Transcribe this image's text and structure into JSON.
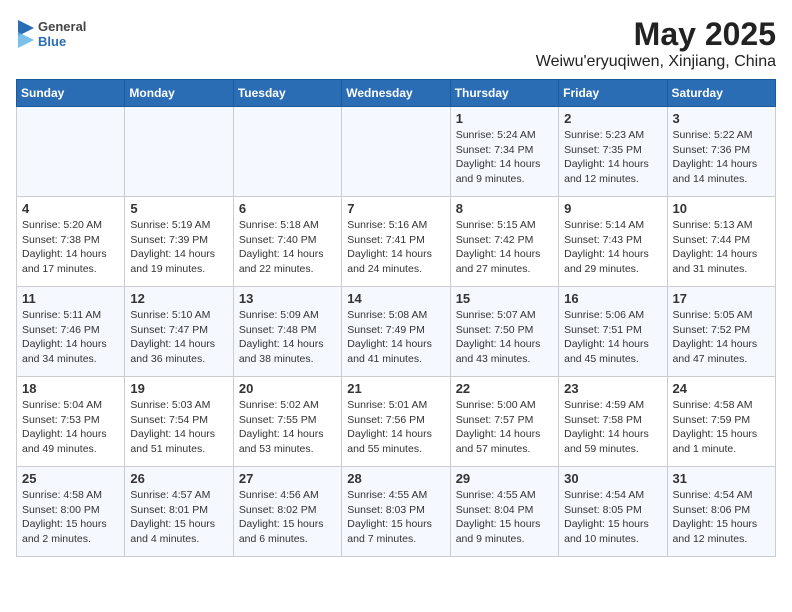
{
  "header": {
    "logo_general": "General",
    "logo_blue": "Blue",
    "title": "May 2025",
    "subtitle": "Weiwu'eryuqiwen, Xinjiang, China"
  },
  "days_of_week": [
    "Sunday",
    "Monday",
    "Tuesday",
    "Wednesday",
    "Thursday",
    "Friday",
    "Saturday"
  ],
  "weeks": [
    [
      {
        "day": "",
        "detail": ""
      },
      {
        "day": "",
        "detail": ""
      },
      {
        "day": "",
        "detail": ""
      },
      {
        "day": "",
        "detail": ""
      },
      {
        "day": "1",
        "detail": "Sunrise: 5:24 AM\nSunset: 7:34 PM\nDaylight: 14 hours\nand 9 minutes."
      },
      {
        "day": "2",
        "detail": "Sunrise: 5:23 AM\nSunset: 7:35 PM\nDaylight: 14 hours\nand 12 minutes."
      },
      {
        "day": "3",
        "detail": "Sunrise: 5:22 AM\nSunset: 7:36 PM\nDaylight: 14 hours\nand 14 minutes."
      }
    ],
    [
      {
        "day": "4",
        "detail": "Sunrise: 5:20 AM\nSunset: 7:38 PM\nDaylight: 14 hours\nand 17 minutes."
      },
      {
        "day": "5",
        "detail": "Sunrise: 5:19 AM\nSunset: 7:39 PM\nDaylight: 14 hours\nand 19 minutes."
      },
      {
        "day": "6",
        "detail": "Sunrise: 5:18 AM\nSunset: 7:40 PM\nDaylight: 14 hours\nand 22 minutes."
      },
      {
        "day": "7",
        "detail": "Sunrise: 5:16 AM\nSunset: 7:41 PM\nDaylight: 14 hours\nand 24 minutes."
      },
      {
        "day": "8",
        "detail": "Sunrise: 5:15 AM\nSunset: 7:42 PM\nDaylight: 14 hours\nand 27 minutes."
      },
      {
        "day": "9",
        "detail": "Sunrise: 5:14 AM\nSunset: 7:43 PM\nDaylight: 14 hours\nand 29 minutes."
      },
      {
        "day": "10",
        "detail": "Sunrise: 5:13 AM\nSunset: 7:44 PM\nDaylight: 14 hours\nand 31 minutes."
      }
    ],
    [
      {
        "day": "11",
        "detail": "Sunrise: 5:11 AM\nSunset: 7:46 PM\nDaylight: 14 hours\nand 34 minutes."
      },
      {
        "day": "12",
        "detail": "Sunrise: 5:10 AM\nSunset: 7:47 PM\nDaylight: 14 hours\nand 36 minutes."
      },
      {
        "day": "13",
        "detail": "Sunrise: 5:09 AM\nSunset: 7:48 PM\nDaylight: 14 hours\nand 38 minutes."
      },
      {
        "day": "14",
        "detail": "Sunrise: 5:08 AM\nSunset: 7:49 PM\nDaylight: 14 hours\nand 41 minutes."
      },
      {
        "day": "15",
        "detail": "Sunrise: 5:07 AM\nSunset: 7:50 PM\nDaylight: 14 hours\nand 43 minutes."
      },
      {
        "day": "16",
        "detail": "Sunrise: 5:06 AM\nSunset: 7:51 PM\nDaylight: 14 hours\nand 45 minutes."
      },
      {
        "day": "17",
        "detail": "Sunrise: 5:05 AM\nSunset: 7:52 PM\nDaylight: 14 hours\nand 47 minutes."
      }
    ],
    [
      {
        "day": "18",
        "detail": "Sunrise: 5:04 AM\nSunset: 7:53 PM\nDaylight: 14 hours\nand 49 minutes."
      },
      {
        "day": "19",
        "detail": "Sunrise: 5:03 AM\nSunset: 7:54 PM\nDaylight: 14 hours\nand 51 minutes."
      },
      {
        "day": "20",
        "detail": "Sunrise: 5:02 AM\nSunset: 7:55 PM\nDaylight: 14 hours\nand 53 minutes."
      },
      {
        "day": "21",
        "detail": "Sunrise: 5:01 AM\nSunset: 7:56 PM\nDaylight: 14 hours\nand 55 minutes."
      },
      {
        "day": "22",
        "detail": "Sunrise: 5:00 AM\nSunset: 7:57 PM\nDaylight: 14 hours\nand 57 minutes."
      },
      {
        "day": "23",
        "detail": "Sunrise: 4:59 AM\nSunset: 7:58 PM\nDaylight: 14 hours\nand 59 minutes."
      },
      {
        "day": "24",
        "detail": "Sunrise: 4:58 AM\nSunset: 7:59 PM\nDaylight: 15 hours\nand 1 minute."
      }
    ],
    [
      {
        "day": "25",
        "detail": "Sunrise: 4:58 AM\nSunset: 8:00 PM\nDaylight: 15 hours\nand 2 minutes."
      },
      {
        "day": "26",
        "detail": "Sunrise: 4:57 AM\nSunset: 8:01 PM\nDaylight: 15 hours\nand 4 minutes."
      },
      {
        "day": "27",
        "detail": "Sunrise: 4:56 AM\nSunset: 8:02 PM\nDaylight: 15 hours\nand 6 minutes."
      },
      {
        "day": "28",
        "detail": "Sunrise: 4:55 AM\nSunset: 8:03 PM\nDaylight: 15 hours\nand 7 minutes."
      },
      {
        "day": "29",
        "detail": "Sunrise: 4:55 AM\nSunset: 8:04 PM\nDaylight: 15 hours\nand 9 minutes."
      },
      {
        "day": "30",
        "detail": "Sunrise: 4:54 AM\nSunset: 8:05 PM\nDaylight: 15 hours\nand 10 minutes."
      },
      {
        "day": "31",
        "detail": "Sunrise: 4:54 AM\nSunset: 8:06 PM\nDaylight: 15 hours\nand 12 minutes."
      }
    ]
  ]
}
